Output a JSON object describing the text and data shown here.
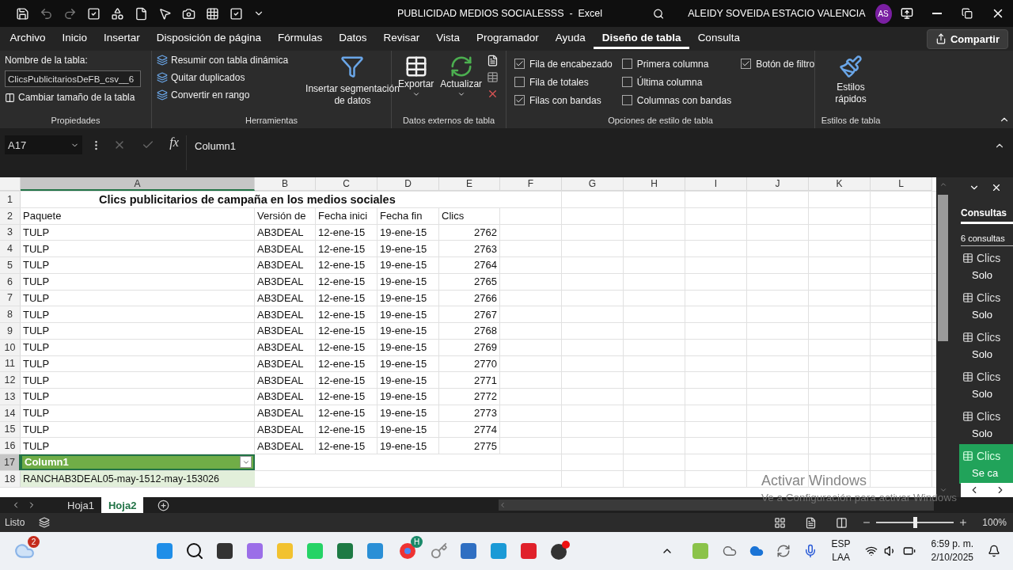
{
  "title_bar": {
    "title": "PUBLICIDAD MEDIOS SOCIALESSS  -  Excel",
    "user": "ALEIDY SOVEIDA ESTACIO VALENCIA",
    "avatar": "AS"
  },
  "menu_tabs": [
    {
      "label": "Archivo",
      "selected": false
    },
    {
      "label": "Inicio",
      "selected": false
    },
    {
      "label": "Insertar",
      "selected": false
    },
    {
      "label": "Disposición de página",
      "selected": false
    },
    {
      "label": "Fórmulas",
      "selected": false
    },
    {
      "label": "Datos",
      "selected": false
    },
    {
      "label": "Revisar",
      "selected": false
    },
    {
      "label": "Vista",
      "selected": false
    },
    {
      "label": "Programador",
      "selected": false
    },
    {
      "label": "Ayuda",
      "selected": false
    },
    {
      "label": "Diseño de tabla",
      "selected": true
    },
    {
      "label": "Consulta",
      "selected": false
    }
  ],
  "share_button": "Compartir",
  "ribbon": {
    "properties": {
      "label": "Nombre de la tabla:",
      "table_name": "ClicsPublicitariosDeFB_csv__6",
      "resize": "Cambiar tamaño de la tabla",
      "group": "Propiedades"
    },
    "tools": {
      "buttons": [
        "Resumir con tabla dinámica",
        "Quitar duplicados",
        "Convertir en rango"
      ],
      "slicer": [
        "Insertar segmentación",
        "de datos"
      ],
      "group": "Herramientas"
    },
    "external": {
      "export": "Exportar",
      "refresh": "Actualizar",
      "group": "Datos externos de tabla"
    },
    "style_options": {
      "options": [
        {
          "label": "Fila de encabezado",
          "checked": true
        },
        {
          "label": "Fila de totales",
          "checked": false
        },
        {
          "label": "Filas con bandas",
          "checked": true
        },
        {
          "label": "Primera columna",
          "checked": false
        },
        {
          "label": "Última columna",
          "checked": false
        },
        {
          "label": "Columnas con bandas",
          "checked": false
        },
        {
          "label": "Botón de filtro",
          "checked": true
        }
      ],
      "group": "Opciones de estilo de tabla"
    },
    "styles": {
      "quick": [
        "Estilos",
        "rápidos"
      ],
      "group": "Estilos de tabla"
    }
  },
  "formula_bar": {
    "name_box": "A17",
    "fx": "fx",
    "value": "Column1"
  },
  "columns": [
    {
      "label": "A",
      "selected": true
    },
    {
      "label": "B",
      "selected": false
    },
    {
      "label": "C",
      "selected": false
    },
    {
      "label": "D",
      "selected": false
    },
    {
      "label": "E",
      "selected": false
    },
    {
      "label": "F",
      "selected": false
    },
    {
      "label": "G",
      "selected": false
    },
    {
      "label": "H",
      "selected": false
    },
    {
      "label": "I",
      "selected": false
    },
    {
      "label": "J",
      "selected": false
    },
    {
      "label": "K",
      "selected": false
    },
    {
      "label": "L",
      "selected": false
    }
  ],
  "rows": [
    {
      "number": "1",
      "selected": false,
      "kind": "title",
      "text": "Clics publicitarios de campaña en los medios sociales"
    },
    {
      "number": "2",
      "selected": false,
      "kind": "data",
      "values": [
        "Paquete",
        "Versión de",
        "Fecha inici",
        "Fecha fin",
        "Clics"
      ]
    },
    {
      "number": "3",
      "selected": false,
      "kind": "data",
      "values": [
        "TULP",
        "AB3DEAL",
        "12-ene-15",
        "19-ene-15",
        "2762"
      ]
    },
    {
      "number": "4",
      "selected": false,
      "kind": "data",
      "values": [
        "TULP",
        "AB3DEAL",
        "12-ene-15",
        "19-ene-15",
        "2763"
      ]
    },
    {
      "number": "5",
      "selected": false,
      "kind": "data",
      "values": [
        "TULP",
        "AB3DEAL",
        "12-ene-15",
        "19-ene-15",
        "2764"
      ]
    },
    {
      "number": "6",
      "selected": false,
      "kind": "data",
      "values": [
        "TULP",
        "AB3DEAL",
        "12-ene-15",
        "19-ene-15",
        "2765"
      ]
    },
    {
      "number": "7",
      "selected": false,
      "kind": "data",
      "values": [
        "TULP",
        "AB3DEAL",
        "12-ene-15",
        "19-ene-15",
        "2766"
      ]
    },
    {
      "number": "8",
      "selected": false,
      "kind": "data",
      "values": [
        "TULP",
        "AB3DEAL",
        "12-ene-15",
        "19-ene-15",
        "2767"
      ]
    },
    {
      "number": "9",
      "selected": false,
      "kind": "data",
      "values": [
        "TULP",
        "AB3DEAL",
        "12-ene-15",
        "19-ene-15",
        "2768"
      ]
    },
    {
      "number": "10",
      "selected": false,
      "kind": "data",
      "values": [
        "TULP",
        "AB3DEAL",
        "12-ene-15",
        "19-ene-15",
        "2769"
      ]
    },
    {
      "number": "11",
      "selected": false,
      "kind": "data",
      "values": [
        "TULP",
        "AB3DEAL",
        "12-ene-15",
        "19-ene-15",
        "2770"
      ]
    },
    {
      "number": "12",
      "selected": false,
      "kind": "data",
      "values": [
        "TULP",
        "AB3DEAL",
        "12-ene-15",
        "19-ene-15",
        "2771"
      ]
    },
    {
      "number": "13",
      "selected": false,
      "kind": "data",
      "values": [
        "TULP",
        "AB3DEAL",
        "12-ene-15",
        "19-ene-15",
        "2772"
      ]
    },
    {
      "number": "14",
      "selected": false,
      "kind": "data",
      "values": [
        "TULP",
        "AB3DEAL",
        "12-ene-15",
        "19-ene-15",
        "2773"
      ]
    },
    {
      "number": "15",
      "selected": false,
      "kind": "data",
      "values": [
        "TULP",
        "AB3DEAL",
        "12-ene-15",
        "19-ene-15",
        "2774"
      ]
    },
    {
      "number": "16",
      "selected": false,
      "kind": "data",
      "values": [
        "TULP",
        "AB3DEAL",
        "12-ene-15",
        "19-ene-15",
        "2775"
      ]
    },
    {
      "number": "17",
      "selected": true,
      "kind": "table_header",
      "text": "Column1"
    },
    {
      "number": "18",
      "selected": false,
      "kind": "table_row",
      "text": "RANCHAB3DEAL05-may-1512-may-153026"
    }
  ],
  "queries_pane": {
    "tab": "Consultas",
    "count": "6 consultas",
    "items": [
      {
        "name": "Clics",
        "status": "Solo",
        "selected": false
      },
      {
        "name": "Clics",
        "status": "Solo",
        "selected": false
      },
      {
        "name": "Clics",
        "status": "Solo",
        "selected": false
      },
      {
        "name": "Clics",
        "status": "Solo",
        "selected": false
      },
      {
        "name": "Clics",
        "status": "Solo",
        "selected": false
      },
      {
        "name": "Clics",
        "status": "Se ca",
        "selected": true
      }
    ]
  },
  "sheet_tabs": [
    {
      "label": "Hoja1",
      "selected": false
    },
    {
      "label": "Hoja2",
      "selected": true
    }
  ],
  "status_bar": {
    "status": "Listo",
    "zoom": {
      "level": 0.5,
      "reading": "100%"
    }
  },
  "activation": {
    "title": "Activar Windows",
    "message": "Ve a Configuración para activar Windows"
  },
  "taskbar": {
    "weather_badge": "2",
    "chrome_badge": "H",
    "language": [
      "ESP",
      "LAA"
    ],
    "time": "6:59 p. m.",
    "date": "2/10/2025"
  }
}
